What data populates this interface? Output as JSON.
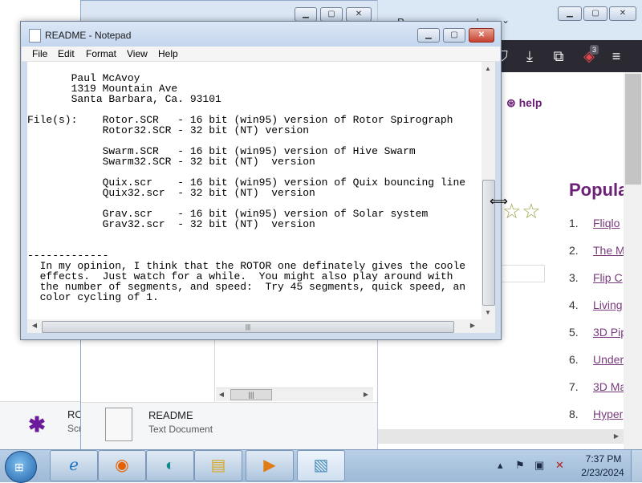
{
  "notepad": {
    "title": "README - Notepad",
    "menu": [
      "File",
      "Edit",
      "Format",
      "View",
      "Help"
    ],
    "content": "       Paul McAvoy\n       1319 Mountain Ave\n       Santa Barbara, Ca. 93101\n\nFile(s):    Rotor.SCR   - 16 bit (win95) version of Rotor Spirograph\n            Rotor32.SCR - 32 bit (NT) version\n\n            Swarm.SCR   - 16 bit (win95) version of Hive Swarm\n            Swarm32.SCR - 32 bit (NT)  version\n\n            Quix.scr    - 16 bit (win95) version of Quix bouncing line\n            Quix32.scr  - 32 bit (NT)  version\n\n            Grav.scr    - 16 bit (win95) version of Solar system\n            Grav32.scr  - 32 bit (NT)  version\n\n\n-------------\n  In my opinion, I think that the ROTOR one definately gives the coole\n  effects.  Just watch for a while.  You might also play around with\n  the number of segments, and speed:  Try 45 segments, quick speed, an\n  color cycling of 1."
  },
  "explorer": {
    "file_name": "README",
    "file_type": "Text Document",
    "left_item_name": "RO",
    "left_item_type": "Scr"
  },
  "browser": {
    "help_link": "help",
    "popular_title": "Popula",
    "popular_items": [
      {
        "num": "1.",
        "label": "Fliqlo"
      },
      {
        "num": "2.",
        "label": "The M"
      },
      {
        "num": "3.",
        "label": "Flip C"
      },
      {
        "num": "4.",
        "label": "Living"
      },
      {
        "num": "5.",
        "label": "3D Pip"
      },
      {
        "num": "6.",
        "label": "Under"
      },
      {
        "num": "7.",
        "label": "3D Ma"
      },
      {
        "num": "8.",
        "label": "Hyper"
      }
    ],
    "extension_badge": "3",
    "tab_label": "P"
  },
  "taskbar": {
    "time": "7:37 PM",
    "date": "2/23/2024"
  },
  "icons": {
    "start": "windows-start-icon",
    "ie": "internet-explorer-icon",
    "firefox": "firefox-icon",
    "edge": "edge-icon",
    "explorer": "file-explorer-icon",
    "media": "media-player-icon",
    "notepad": "notepad-icon"
  }
}
